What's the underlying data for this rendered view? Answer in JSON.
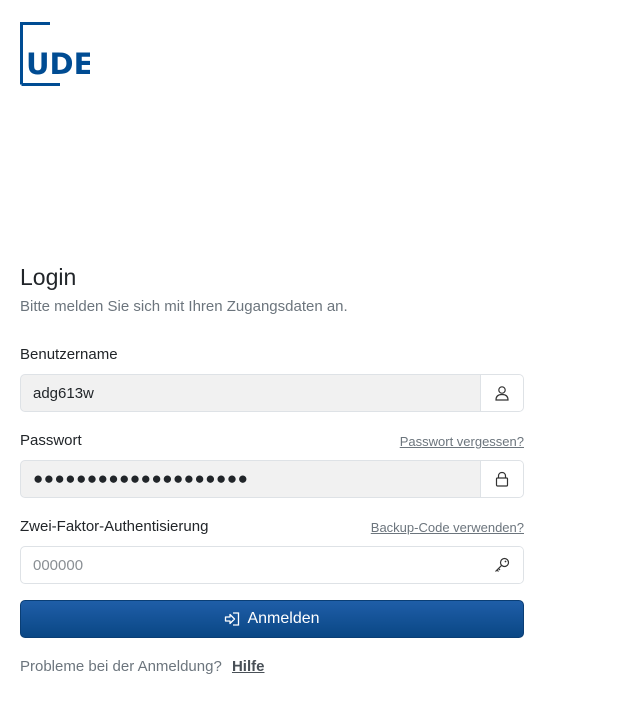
{
  "brand": {
    "logo_text": "UDE",
    "color": "#004c93"
  },
  "login": {
    "title": "Login",
    "subtitle": "Bitte melden Sie sich mit Ihren Zugangsdaten an."
  },
  "username": {
    "label": "Benutzername",
    "value": "adg613w",
    "icon": "user-icon"
  },
  "password": {
    "label": "Passwort",
    "forgot_link": "Passwort vergessen?",
    "masked_value": "●●●●●●●●●●●●●●●●●●●●",
    "icon": "lock-icon"
  },
  "twofactor": {
    "label": "Zwei-Faktor-Authentisierung",
    "backup_link": "Backup-Code verwenden?",
    "placeholder": "000000",
    "icon": "key-icon"
  },
  "submit": {
    "label": "Anmelden",
    "icon": "sign-in-icon",
    "color": "#0a4785"
  },
  "help": {
    "text": "Probleme bei der Anmeldung?",
    "link": "Hilfe"
  }
}
